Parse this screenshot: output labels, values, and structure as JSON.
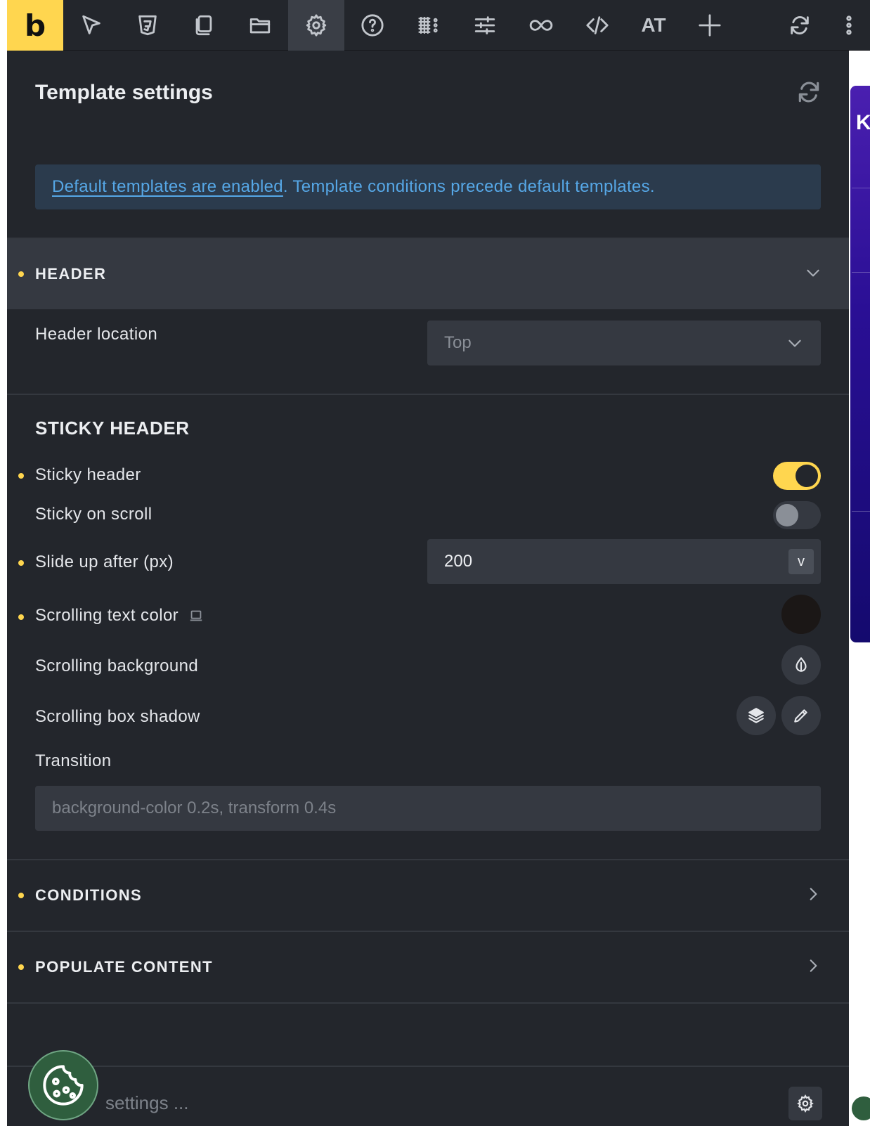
{
  "toolbar": {
    "logo": "b",
    "text_button": "AT",
    "icons": [
      "cursor-icon",
      "css3-icon",
      "pages-icon",
      "folder-icon",
      "gear-icon",
      "help-icon",
      "grid-icon",
      "sliders-icon",
      "infinity-icon",
      "code-icon",
      "plus-icon",
      "refresh-icon",
      "kebab-icon"
    ],
    "active": "gear-icon",
    "accent": "#ffd64f"
  },
  "panel": {
    "title": "Template settings",
    "notice_link": "Default templates are enabled",
    "notice_rest": ". Template conditions precede default templates."
  },
  "header_group": {
    "label": "HEADER",
    "location_label": "Header location",
    "location_value": "Top"
  },
  "sticky": {
    "title": "STICKY HEADER",
    "sticky_header_label": "Sticky header",
    "sticky_header_on": true,
    "sticky_on_scroll_label": "Sticky on scroll",
    "sticky_on_scroll_on": false,
    "slide_up_label": "Slide up after (px)",
    "slide_up_value": "200",
    "slide_up_unit": "v",
    "scroll_text_color_label": "Scrolling text color",
    "scroll_text_color": "#1b1716",
    "scroll_bg_label": "Scrolling background",
    "scroll_shadow_label": "Scrolling box shadow",
    "transition_label": "Transition",
    "transition_placeholder": "background-color 0.2s, transform 0.4s"
  },
  "groups": {
    "conditions": "CONDITIONS",
    "populate": "POPULATE CONTENT"
  },
  "footer": {
    "search_placeholder": "settings ..."
  },
  "preview": {
    "hero_letter": "K"
  }
}
